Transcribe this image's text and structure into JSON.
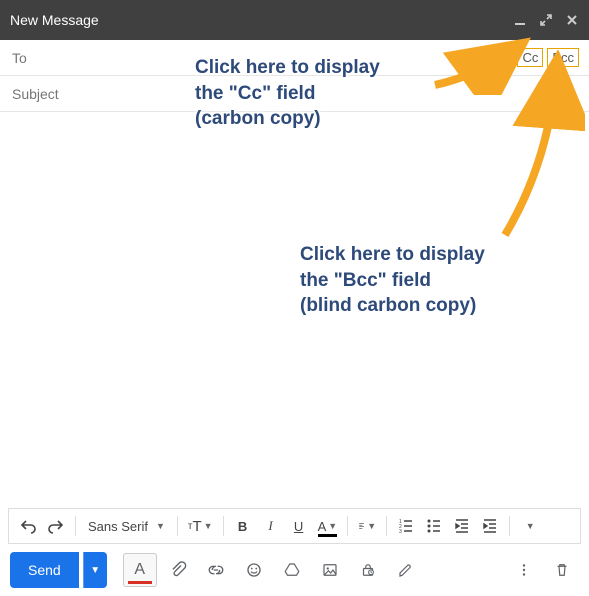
{
  "header": {
    "title": "New Message"
  },
  "to": {
    "label": "To",
    "cc": "Cc",
    "bcc": "Bcc"
  },
  "subject": {
    "placeholder": "Subject"
  },
  "fmt": {
    "font": "Sans Serif",
    "size_glyph": "тТ",
    "bold": "B",
    "italic": "I",
    "underline": "U",
    "color": "A"
  },
  "send": {
    "label": "Send",
    "text_color_glyph": "A"
  },
  "annotations": {
    "cc_text": "Click here to display\nthe \"Cc\" field\n(carbon copy)",
    "bcc_text": "Click here to display\nthe \"Bcc\" field\n(blind carbon copy)"
  }
}
